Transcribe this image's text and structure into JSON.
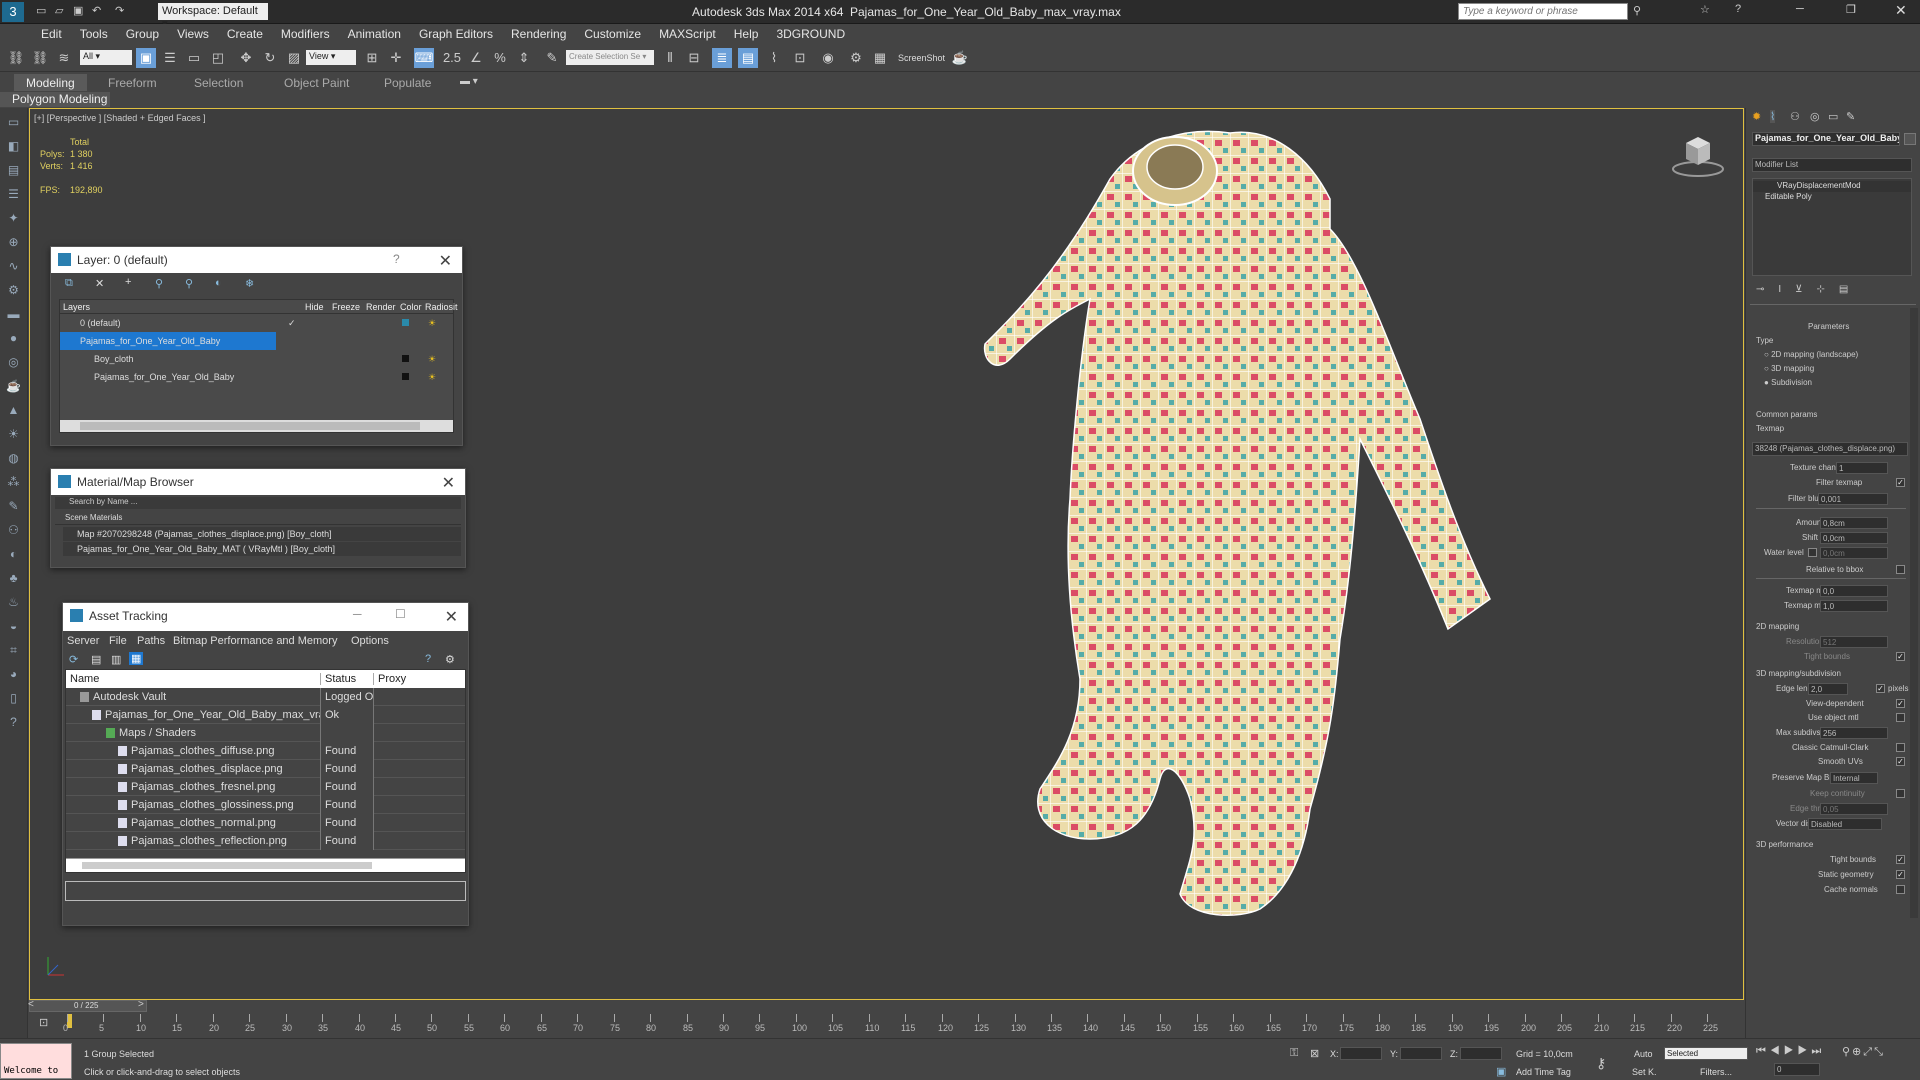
{
  "titlebar": {
    "workspace": "Workspace: Default",
    "app": "Autodesk 3ds Max  2014 x64",
    "file": "Pajamas_for_One_Year_Old_Baby_max_vray.max",
    "search_placeholder": "Type a keyword or phrase"
  },
  "menu": [
    "Edit",
    "Tools",
    "Group",
    "Views",
    "Create",
    "Modifiers",
    "Animation",
    "Graph Editors",
    "Rendering",
    "Customize",
    "MAXScript",
    "Help",
    "3DGROUND"
  ],
  "toolbar": {
    "filter": "All",
    "ref_coord": "View",
    "selection_set": "Create Selection Se",
    "screenshot": "ScreenShot"
  },
  "ribbon": {
    "tabs": [
      "Modeling",
      "Freeform",
      "Selection",
      "Object Paint",
      "Populate"
    ],
    "sub": "Polygon Modeling"
  },
  "viewport": {
    "label": "[+] [Perspective ] [Shaded + Edged Faces ]",
    "stats_total": "Total",
    "polys_label": "Polys:",
    "polys": "1 380",
    "verts_label": "Verts:",
    "verts": "1 416",
    "fps_label": "FPS:",
    "fps": "192,890"
  },
  "layer_window": {
    "title": "Layer: 0 (default)",
    "cols": [
      "Layers",
      "Hide",
      "Freeze",
      "Render",
      "Color",
      "Radiosit"
    ],
    "rows": [
      "0 (default)",
      "Pajamas_for_One_Year_Old_Baby",
      "Boy_cloth",
      "Pajamas_for_One_Year_Old_Baby"
    ],
    "help": "?"
  },
  "material_browser": {
    "title": "Material/Map Browser",
    "search": "Search by Name ...",
    "section": "Scene Materials",
    "items": [
      "Map #2070298248 (Pajamas_clothes_displace.png) [Boy_cloth]",
      "Pajamas_for_One_Year_Old_Baby_MAT ( VRayMtl ) [Boy_cloth]"
    ]
  },
  "asset_tracking": {
    "title": "Asset Tracking",
    "menu": [
      "Server",
      "File",
      "Paths",
      "Bitmap Performance and Memory",
      "Options"
    ],
    "cols": [
      "Name",
      "Status",
      "Proxy"
    ],
    "rows": [
      {
        "name": "Autodesk Vault",
        "status": "Logged O..."
      },
      {
        "name": "Pajamas_for_One_Year_Old_Baby_max_vray.max",
        "status": "Ok"
      },
      {
        "name": "Maps / Shaders",
        "status": ""
      },
      {
        "name": "Pajamas_clothes_diffuse.png",
        "status": "Found"
      },
      {
        "name": "Pajamas_clothes_displace.png",
        "status": "Found"
      },
      {
        "name": "Pajamas_clothes_fresnel.png",
        "status": "Found"
      },
      {
        "name": "Pajamas_clothes_glossiness.png",
        "status": "Found"
      },
      {
        "name": "Pajamas_clothes_normal.png",
        "status": "Found"
      },
      {
        "name": "Pajamas_clothes_reflection.png",
        "status": "Found"
      }
    ]
  },
  "command_panel": {
    "object_name": "Pajamas_for_One_Year_Old_Baby",
    "modifier_list": "Modifier List",
    "stack": [
      "VRayDisplacementMod",
      "Editable Poly"
    ],
    "parameters": "Parameters",
    "type_label": "Type",
    "types": [
      "2D mapping (landscape)",
      "3D mapping",
      "Subdivision"
    ],
    "common": "Common params",
    "texmap_label": "Texmap",
    "texmap": "38248 (Pajamas_clothes_displace.png)",
    "texture_chan_label": "Texture chan",
    "texture_chan": "1",
    "filter_texmap": "Filter texmap",
    "filter_blur_label": "Filter blur",
    "filter_blur": "0,001",
    "amount_label": "Amount",
    "amount": "0,8cm",
    "shift_label": "Shift",
    "shift": "0,0cm",
    "water_label": "Water level",
    "water": "0,0cm",
    "relative_bbox": "Relative to bbox",
    "texmap_min_label": "Texmap min",
    "texmap_min": "0,0",
    "texmap_max_label": "Texmap max",
    "texmap_max": "1,0",
    "mapping2d": "2D mapping",
    "resolution_label": "Resolution",
    "resolution": "512",
    "tight_bounds": "Tight bounds",
    "mapping3d": "3D mapping/subdivision",
    "edge_length_label": "Edge length",
    "edge_length": "2,0",
    "pixels": "pixels",
    "view_dependent": "View-dependent",
    "use_object_mtl": "Use object mtl",
    "max_subdivs_label": "Max subdivs",
    "max_subdivs": "256",
    "catmull": "Classic Catmull-Clark",
    "smooth_uvs": "Smooth UVs",
    "preserve_label": "Preserve Map Bnd",
    "preserve": "Internal",
    "keep_continuity": "Keep continuity",
    "edge_thresh_label": "Edge thresh",
    "edge_thresh": "0,05",
    "vector_label": "Vector displ",
    "vector": "Disabled",
    "perf": "3D performance",
    "perf_tight": "Tight bounds",
    "static_geo": "Static geometry",
    "cache_normals": "Cache normals"
  },
  "timeline": {
    "frame": "0 / 225",
    "ticks": [
      "0",
      "5",
      "10",
      "15",
      "20",
      "25",
      "30",
      "35",
      "40",
      "45",
      "50",
      "55",
      "60",
      "65",
      "70",
      "75",
      "80",
      "85",
      "90",
      "95",
      "100",
      "105",
      "110",
      "115",
      "120",
      "125",
      "130",
      "135",
      "140",
      "145",
      "150",
      "155",
      "160",
      "165",
      "170",
      "175",
      "180",
      "185",
      "190",
      "195",
      "200",
      "205",
      "210",
      "215",
      "220",
      "225"
    ]
  },
  "status": {
    "maxscript": "Welcome to",
    "selected": "1 Group Selected",
    "prompt": "Click or click-and-drag to select objects",
    "x_label": "X:",
    "y_label": "Y:",
    "z_label": "Z:",
    "grid": "Grid = 10,0cm",
    "add_time_tag": "Add Time Tag",
    "auto": "Auto",
    "set_key": "Set K.",
    "key_mode": "Selected",
    "filters": "Filters...",
    "frame_field": "0"
  },
  "colors": {
    "accent": "#1e78d0",
    "viewport_border": "#e0c040",
    "stat_text": "#e0d060"
  }
}
